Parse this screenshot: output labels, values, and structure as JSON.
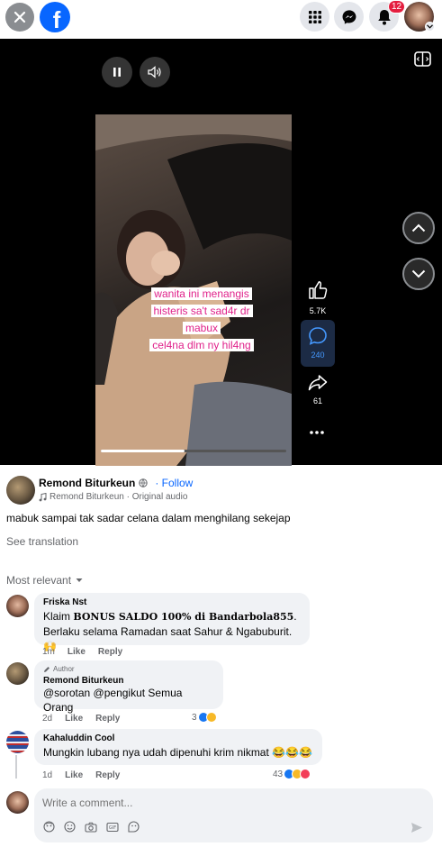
{
  "topbar": {
    "notifications_count": "12",
    "brand_color": "#0866ff"
  },
  "video": {
    "caption_lines": [
      "wanita ini menangis",
      "histeris sa't sad4r dr",
      "mabux",
      "cel4na dlm ny hil4ng"
    ],
    "likes": "5.7K",
    "comments": "240",
    "shares": "61",
    "progress": 0.45
  },
  "post": {
    "author": "Remond Biturkeun",
    "follow_label": "· Follow",
    "audio": "Remond Biturkeun · Original audio",
    "caption": "mabuk sampai tak sadar celana dalam menghilang sekejap",
    "see_translation": "See translation",
    "sort_label": "Most relevant"
  },
  "comments": [
    {
      "name": "Friska Nst",
      "line1_prefix": "Klaim ",
      "line1_bold": "BONUS SALDO 100% di Bandarbola855",
      "line1_suffix": ".",
      "line2": "Berlaku selama Ramadan saat Sahur & Ngabuburit. 🙌",
      "time": "1m",
      "like": "Like",
      "reply": "Reply"
    },
    {
      "author_tag": "Author",
      "name": "Remond Biturkeun",
      "text": "@sorotan @pengikut Semua Orang",
      "time": "2d",
      "like": "Like",
      "reply": "Reply",
      "reactions": "3"
    },
    {
      "name": "Kahaluddin Cool",
      "text": "Mungkin lubang nya udah dipenuhi krim nikmat 😂😂😂",
      "time": "1d",
      "like": "Like",
      "reply": "Reply",
      "reactions": "43"
    }
  ],
  "composer": {
    "placeholder": "Write a comment..."
  }
}
